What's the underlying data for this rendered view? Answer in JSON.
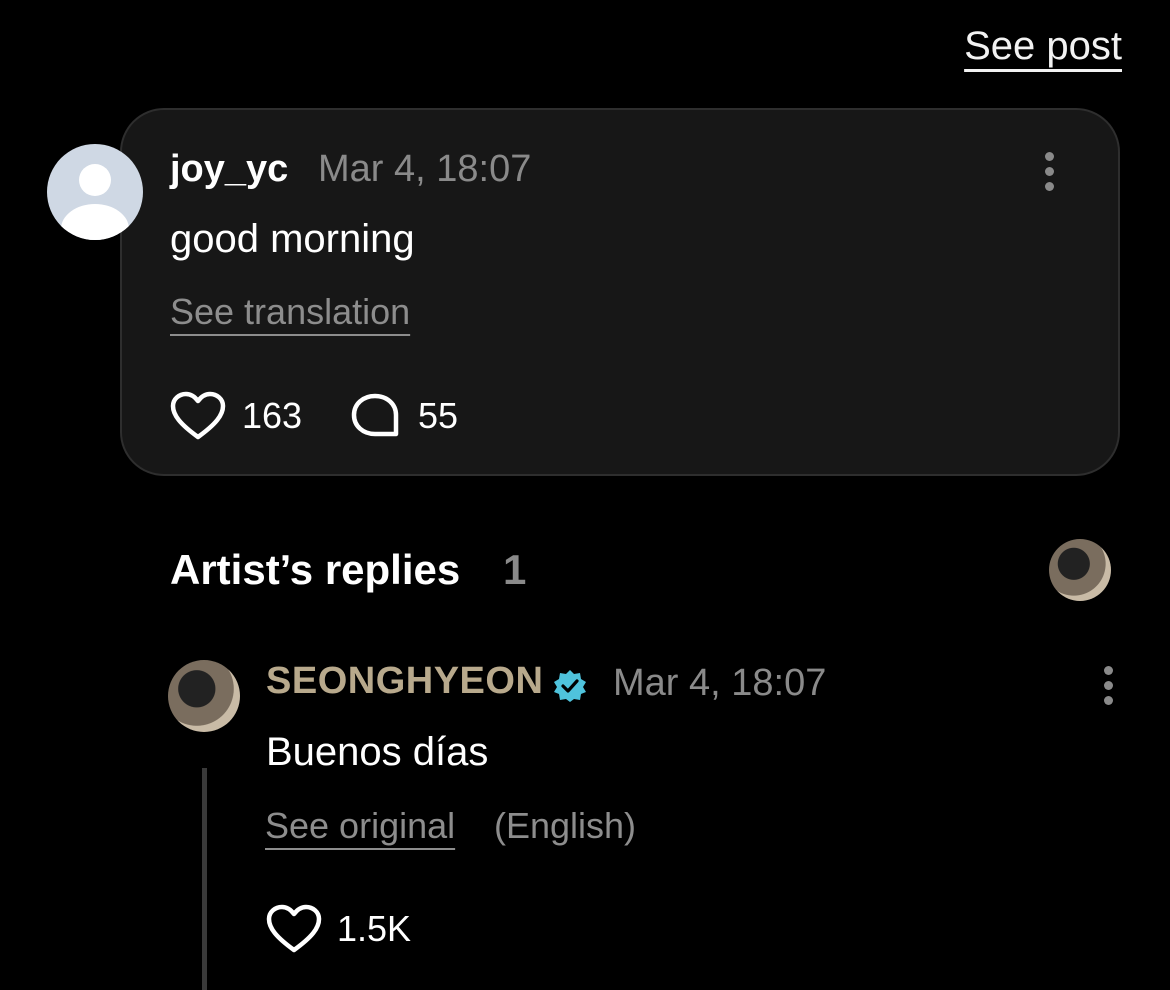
{
  "header": {
    "see_post": "See post"
  },
  "post": {
    "username": "joy_yc",
    "timestamp": "Mar 4, 18:07",
    "text": "good morning",
    "see_translation": "See translation",
    "likes": "163",
    "replies": "55"
  },
  "artist_replies": {
    "title": "Artist’s replies",
    "count": "1",
    "items": [
      {
        "name": "SEONGHYEON",
        "verified_icon": "verified-badge-icon",
        "timestamp": "Mar 4, 18:07",
        "text": "Buenos días",
        "see_original": "See original",
        "original_language": "(English)",
        "likes": "1.5K"
      }
    ]
  },
  "colors": {
    "background": "#000000",
    "card": "#171717",
    "artist_name": "#b8a98c",
    "verified": "#4fc3dc",
    "muted": "#8a8a8a"
  }
}
